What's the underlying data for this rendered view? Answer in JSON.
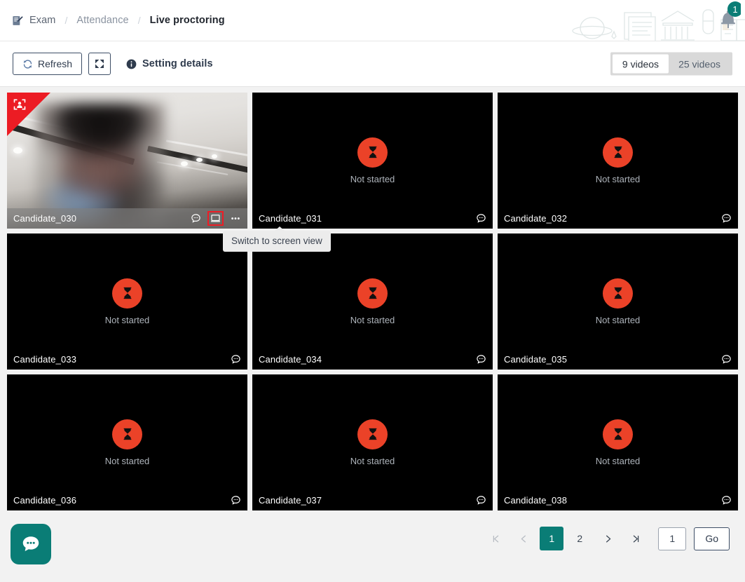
{
  "breadcrumb": {
    "icon": "exam-icon",
    "items": [
      {
        "label": "Exam",
        "active": false
      },
      {
        "label": "Attendance",
        "active": false
      },
      {
        "label": "Live proctoring",
        "active": true
      }
    ],
    "separator": "/"
  },
  "notifications": {
    "badge_count": "1",
    "icon": "bell-icon"
  },
  "toolbar": {
    "refresh_label": "Refresh",
    "refresh_icon": "refresh-icon",
    "fullscreen_icon": "expand-icon",
    "setting_details_label": "Setting details",
    "setting_details_icon": "info-icon",
    "view_options": [
      {
        "label": "9 videos",
        "active": true
      },
      {
        "label": "25 videos",
        "active": false
      }
    ]
  },
  "tooltip": {
    "text": "Switch to screen view",
    "visible": true
  },
  "status": {
    "not_started_label": "Not started",
    "not_started_icon": "hourglass-icon",
    "not_started_color": "#eb4228"
  },
  "colors": {
    "accent_teal": "#0a7d76",
    "alert_red": "#ec1c24",
    "status_red": "#eb4228",
    "page_bg": "#f2f2f2",
    "panel_bg": "#ffffff"
  },
  "tiles": [
    {
      "name": "Candidate_030",
      "state": "live",
      "flagged": true,
      "flag_icon": "face-scan-icon",
      "icons": [
        "chat-icon",
        "screen-view-icon",
        "more-options-icon"
      ],
      "highlighted_icon": "screen-view-icon"
    },
    {
      "name": "Candidate_031",
      "state": "not-started",
      "flagged": false,
      "icons": [
        "chat-icon"
      ]
    },
    {
      "name": "Candidate_032",
      "state": "not-started",
      "flagged": false,
      "icons": [
        "chat-icon"
      ]
    },
    {
      "name": "Candidate_033",
      "state": "not-started",
      "flagged": false,
      "icons": [
        "chat-icon"
      ]
    },
    {
      "name": "Candidate_034",
      "state": "not-started",
      "flagged": false,
      "icons": [
        "chat-icon"
      ]
    },
    {
      "name": "Candidate_035",
      "state": "not-started",
      "flagged": false,
      "icons": [
        "chat-icon"
      ]
    },
    {
      "name": "Candidate_036",
      "state": "not-started",
      "flagged": false,
      "icons": [
        "chat-icon"
      ]
    },
    {
      "name": "Candidate_037",
      "state": "not-started",
      "flagged": false,
      "icons": [
        "chat-icon"
      ]
    },
    {
      "name": "Candidate_038",
      "state": "not-started",
      "flagged": false,
      "icons": [
        "chat-icon"
      ]
    }
  ],
  "chat_fab": {
    "icon": "chat-bubble-icon"
  },
  "pagination": {
    "first_icon": "first-page-icon",
    "prev_icon": "prev-page-icon",
    "next_icon": "next-page-icon",
    "last_icon": "last-page-icon",
    "pages": [
      {
        "label": "1",
        "active": true
      },
      {
        "label": "2",
        "active": false
      }
    ],
    "jump_value": "1",
    "go_label": "Go"
  }
}
